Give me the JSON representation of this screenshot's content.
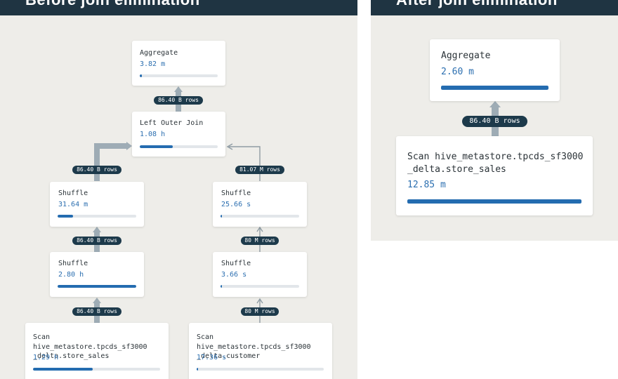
{
  "before": {
    "title": "Before join elimination",
    "nodes": {
      "aggregate": {
        "title": "Aggregate",
        "value": "3.82 m",
        "progress": 0.03
      },
      "join": {
        "title": "Left Outer Join",
        "value": "1.08 h",
        "progress": 0.42
      },
      "shuffle_left_top": {
        "title": "Shuffle",
        "value": "31.64 m",
        "progress": 0.2
      },
      "shuffle_right_top": {
        "title": "Shuffle",
        "value": "25.66 s",
        "progress": 0.02
      },
      "shuffle_left_bottom": {
        "title": "Shuffle",
        "value": "2.80 h",
        "progress": 1.0
      },
      "shuffle_right_bottom": {
        "title": "Shuffle",
        "value": "3.66 s",
        "progress": 0.02
      },
      "scan_store_sales": {
        "title": "Scan hive_metastore.tpcds_sf3000\n_delta.store_sales",
        "value": "1.29 h",
        "progress": 0.47
      },
      "scan_customer": {
        "title": "Scan hive_metastore.tpcds_sf3000\n_delta.customer",
        "value": "17.36 s",
        "progress": 0.01
      }
    },
    "edges": {
      "join_to_aggregate": "86.40 B rows",
      "shuffle_left_to_join": "86.40 B rows",
      "shuffle_right_to_join": "81.07 M rows",
      "shuffle_left_bottom_to_top": "86.40 B rows",
      "shuffle_right_bottom_to_top": "80 M rows",
      "scan_store_sales_to_shuffle": "86.40 B rows",
      "scan_customer_to_shuffle": "80 M rows"
    }
  },
  "after": {
    "title": "After join elimination",
    "nodes": {
      "aggregate": {
        "title": "Aggregate",
        "value": "2.60 m",
        "progress": 1.0
      },
      "scan_store_sales": {
        "title": "Scan  hive_metastore.tpcds_sf3000\n_delta.store_sales",
        "value": "12.85 m",
        "progress": 1.0
      }
    },
    "edges": {
      "scan_to_aggregate": "86.40 B rows"
    }
  },
  "colors": {
    "header": "#1f3442",
    "canvas": "#eeede9",
    "thick_edge": "#9eacb5",
    "thin_edge": "#8f9ca4",
    "pill": "#1d3a4b",
    "value_text": "#2c6fb0",
    "bar_fill": "#246cb0",
    "bar_track": "#e2e6ea"
  }
}
